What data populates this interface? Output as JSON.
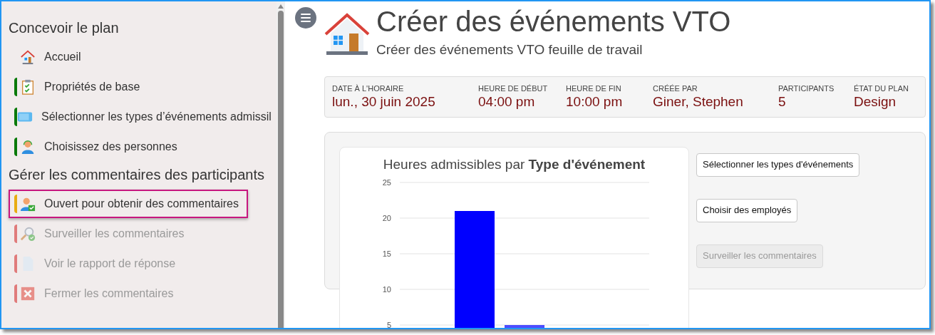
{
  "sidebar": {
    "sections": [
      {
        "title": "Concevoir le plan",
        "items": [
          {
            "label": "Accueil",
            "kind": "home",
            "disabled": false,
            "selected": false
          },
          {
            "label": "Propriétés de base",
            "kind": "checklist",
            "color": "#0a7a0a",
            "disabled": false,
            "selected": false
          },
          {
            "label": "Sélectionner les types d’événements admissil",
            "kind": "screen",
            "color": "#0a7a0a",
            "disabled": false,
            "selected": false
          },
          {
            "label": "Choisissez des personnes",
            "kind": "person",
            "color": "#0a7a0a",
            "disabled": false,
            "selected": false
          }
        ]
      },
      {
        "title": "Gérer les commentaires des participants",
        "items": [
          {
            "label": "Ouvert pour obtenir des commentaires",
            "kind": "person-check",
            "color": "#e8ac12",
            "disabled": false,
            "selected": true
          },
          {
            "label": "Surveiller les commentaires",
            "kind": "magnifier",
            "color": "#e07b7b",
            "disabled": true,
            "selected": false
          },
          {
            "label": "Voir le rapport de réponse",
            "kind": "document",
            "color": "#e07b7b",
            "disabled": true,
            "selected": false
          },
          {
            "label": "Fermer les commentaires",
            "kind": "close",
            "color": "#e07b7b",
            "disabled": true,
            "selected": false
          }
        ]
      }
    ]
  },
  "header": {
    "title": "Créer des événements VTO",
    "subtitle": "Créer des événements VTO feuille de travail"
  },
  "info": [
    {
      "label": "DATE À L'HORAIRE",
      "value": "lun., 30 juin 2025"
    },
    {
      "label": "HEURE DE DÉBUT",
      "value": "04:00 pm"
    },
    {
      "label": "HEURE DE FIN",
      "value": "10:00 pm"
    },
    {
      "label": "CRÉÉE PAR",
      "value": "Giner, Stephen"
    },
    {
      "label": "PARTICIPANTS",
      "value": "5"
    },
    {
      "label": "ÉTAT DU PLAN",
      "value": "Design"
    }
  ],
  "chart": {
    "chart_data": {
      "type": "bar",
      "title": "Heures admissibles par **Type d'événement**",
      "ylim": [
        0,
        25
      ],
      "grid": true,
      "yticks": [
        5,
        10,
        15,
        20,
        25
      ],
      "series": [
        {
          "color": "#0000ff",
          "values": [
            21
          ]
        },
        {
          "color": "#4d4dff",
          "values": [
            5
          ]
        }
      ]
    }
  },
  "actions": [
    {
      "label": "Sélectionner les types d'événements",
      "disabled": false
    },
    {
      "label": "Choisir des employés",
      "disabled": false
    },
    {
      "label": "Surveiller les commentaires",
      "disabled": true
    }
  ]
}
